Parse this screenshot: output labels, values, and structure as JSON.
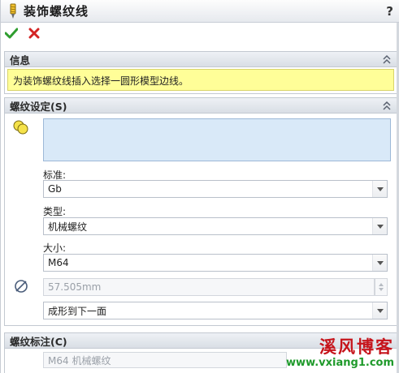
{
  "window": {
    "title": "装饰螺纹线",
    "help": "?"
  },
  "actions": {
    "ok": "✔",
    "cancel": "✖"
  },
  "info_section": {
    "header": "信息",
    "message": "为装饰螺纹线插入选择一圆形模型边线。"
  },
  "thread_section": {
    "header": "螺纹设定(S)",
    "selection_value": "",
    "standard": {
      "label": "标准:",
      "value": "Gb"
    },
    "type": {
      "label": "类型:",
      "value": "机械螺纹"
    },
    "size": {
      "label": "大小:",
      "value": "M64"
    },
    "diameter": {
      "value": "57.505mm"
    },
    "end_condition": {
      "value": "成形到下一面"
    }
  },
  "callout_section": {
    "header": "螺纹标注(C)",
    "value": "M64 机械螺纹"
  },
  "watermark": {
    "title": "溪风博客",
    "url": "www.vxiang1.com"
  }
}
